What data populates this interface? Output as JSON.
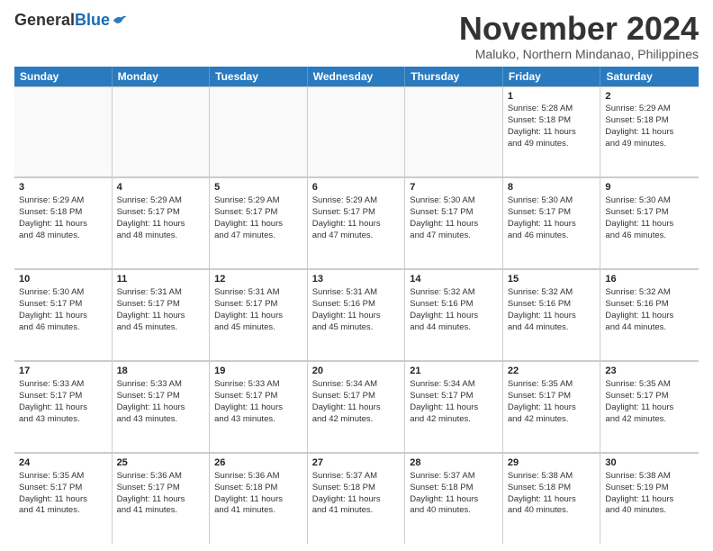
{
  "header": {
    "logo": {
      "general": "General",
      "blue": "Blue"
    },
    "title": "November 2024",
    "location": "Maluko, Northern Mindanao, Philippines"
  },
  "weekdays": [
    "Sunday",
    "Monday",
    "Tuesday",
    "Wednesday",
    "Thursday",
    "Friday",
    "Saturday"
  ],
  "weeks": [
    [
      {
        "day": "",
        "info": "",
        "empty": true
      },
      {
        "day": "",
        "info": "",
        "empty": true
      },
      {
        "day": "",
        "info": "",
        "empty": true
      },
      {
        "day": "",
        "info": "",
        "empty": true
      },
      {
        "day": "",
        "info": "",
        "empty": true
      },
      {
        "day": "1",
        "info": "Sunrise: 5:28 AM\nSunset: 5:18 PM\nDaylight: 11 hours\nand 49 minutes."
      },
      {
        "day": "2",
        "info": "Sunrise: 5:29 AM\nSunset: 5:18 PM\nDaylight: 11 hours\nand 49 minutes."
      }
    ],
    [
      {
        "day": "3",
        "info": "Sunrise: 5:29 AM\nSunset: 5:18 PM\nDaylight: 11 hours\nand 48 minutes."
      },
      {
        "day": "4",
        "info": "Sunrise: 5:29 AM\nSunset: 5:17 PM\nDaylight: 11 hours\nand 48 minutes."
      },
      {
        "day": "5",
        "info": "Sunrise: 5:29 AM\nSunset: 5:17 PM\nDaylight: 11 hours\nand 47 minutes."
      },
      {
        "day": "6",
        "info": "Sunrise: 5:29 AM\nSunset: 5:17 PM\nDaylight: 11 hours\nand 47 minutes."
      },
      {
        "day": "7",
        "info": "Sunrise: 5:30 AM\nSunset: 5:17 PM\nDaylight: 11 hours\nand 47 minutes."
      },
      {
        "day": "8",
        "info": "Sunrise: 5:30 AM\nSunset: 5:17 PM\nDaylight: 11 hours\nand 46 minutes."
      },
      {
        "day": "9",
        "info": "Sunrise: 5:30 AM\nSunset: 5:17 PM\nDaylight: 11 hours\nand 46 minutes."
      }
    ],
    [
      {
        "day": "10",
        "info": "Sunrise: 5:30 AM\nSunset: 5:17 PM\nDaylight: 11 hours\nand 46 minutes."
      },
      {
        "day": "11",
        "info": "Sunrise: 5:31 AM\nSunset: 5:17 PM\nDaylight: 11 hours\nand 45 minutes."
      },
      {
        "day": "12",
        "info": "Sunrise: 5:31 AM\nSunset: 5:17 PM\nDaylight: 11 hours\nand 45 minutes."
      },
      {
        "day": "13",
        "info": "Sunrise: 5:31 AM\nSunset: 5:16 PM\nDaylight: 11 hours\nand 45 minutes."
      },
      {
        "day": "14",
        "info": "Sunrise: 5:32 AM\nSunset: 5:16 PM\nDaylight: 11 hours\nand 44 minutes."
      },
      {
        "day": "15",
        "info": "Sunrise: 5:32 AM\nSunset: 5:16 PM\nDaylight: 11 hours\nand 44 minutes."
      },
      {
        "day": "16",
        "info": "Sunrise: 5:32 AM\nSunset: 5:16 PM\nDaylight: 11 hours\nand 44 minutes."
      }
    ],
    [
      {
        "day": "17",
        "info": "Sunrise: 5:33 AM\nSunset: 5:17 PM\nDaylight: 11 hours\nand 43 minutes."
      },
      {
        "day": "18",
        "info": "Sunrise: 5:33 AM\nSunset: 5:17 PM\nDaylight: 11 hours\nand 43 minutes."
      },
      {
        "day": "19",
        "info": "Sunrise: 5:33 AM\nSunset: 5:17 PM\nDaylight: 11 hours\nand 43 minutes."
      },
      {
        "day": "20",
        "info": "Sunrise: 5:34 AM\nSunset: 5:17 PM\nDaylight: 11 hours\nand 42 minutes."
      },
      {
        "day": "21",
        "info": "Sunrise: 5:34 AM\nSunset: 5:17 PM\nDaylight: 11 hours\nand 42 minutes."
      },
      {
        "day": "22",
        "info": "Sunrise: 5:35 AM\nSunset: 5:17 PM\nDaylight: 11 hours\nand 42 minutes."
      },
      {
        "day": "23",
        "info": "Sunrise: 5:35 AM\nSunset: 5:17 PM\nDaylight: 11 hours\nand 42 minutes."
      }
    ],
    [
      {
        "day": "24",
        "info": "Sunrise: 5:35 AM\nSunset: 5:17 PM\nDaylight: 11 hours\nand 41 minutes."
      },
      {
        "day": "25",
        "info": "Sunrise: 5:36 AM\nSunset: 5:17 PM\nDaylight: 11 hours\nand 41 minutes."
      },
      {
        "day": "26",
        "info": "Sunrise: 5:36 AM\nSunset: 5:18 PM\nDaylight: 11 hours\nand 41 minutes."
      },
      {
        "day": "27",
        "info": "Sunrise: 5:37 AM\nSunset: 5:18 PM\nDaylight: 11 hours\nand 41 minutes."
      },
      {
        "day": "28",
        "info": "Sunrise: 5:37 AM\nSunset: 5:18 PM\nDaylight: 11 hours\nand 40 minutes."
      },
      {
        "day": "29",
        "info": "Sunrise: 5:38 AM\nSunset: 5:18 PM\nDaylight: 11 hours\nand 40 minutes."
      },
      {
        "day": "30",
        "info": "Sunrise: 5:38 AM\nSunset: 5:19 PM\nDaylight: 11 hours\nand 40 minutes."
      }
    ]
  ]
}
